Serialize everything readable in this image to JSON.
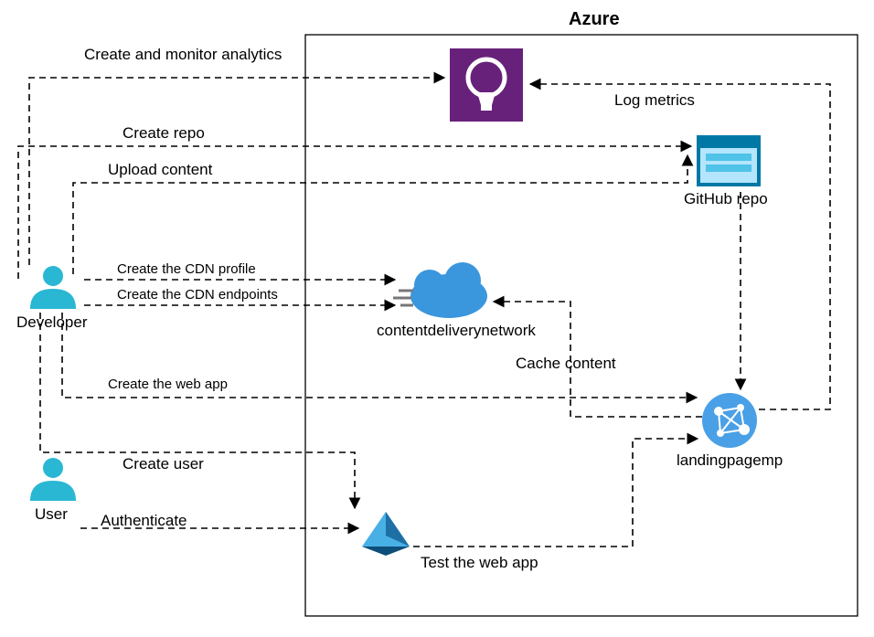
{
  "diagram": {
    "title": "Azure",
    "actors": {
      "developer": "Developer",
      "user": "User"
    },
    "nodes": {
      "analytics": "",
      "github": "GitHub repo",
      "cdn": "contentdeliverynetwork",
      "webapp": "landingpagemp",
      "aad": ""
    },
    "edges": {
      "create_monitor_analytics": "Create and monitor analytics",
      "log_metrics": "Log metrics",
      "create_repo": "Create repo",
      "upload_content": "Upload content",
      "create_cdn_profile": "Create the CDN profile",
      "create_cdn_endpoints": "Create the CDN endpoints",
      "cache_content": "Cache content",
      "create_web_app": "Create the web app",
      "create_user": "Create user",
      "authenticate": "Authenticate",
      "test_web_app": "Test the web app"
    }
  }
}
